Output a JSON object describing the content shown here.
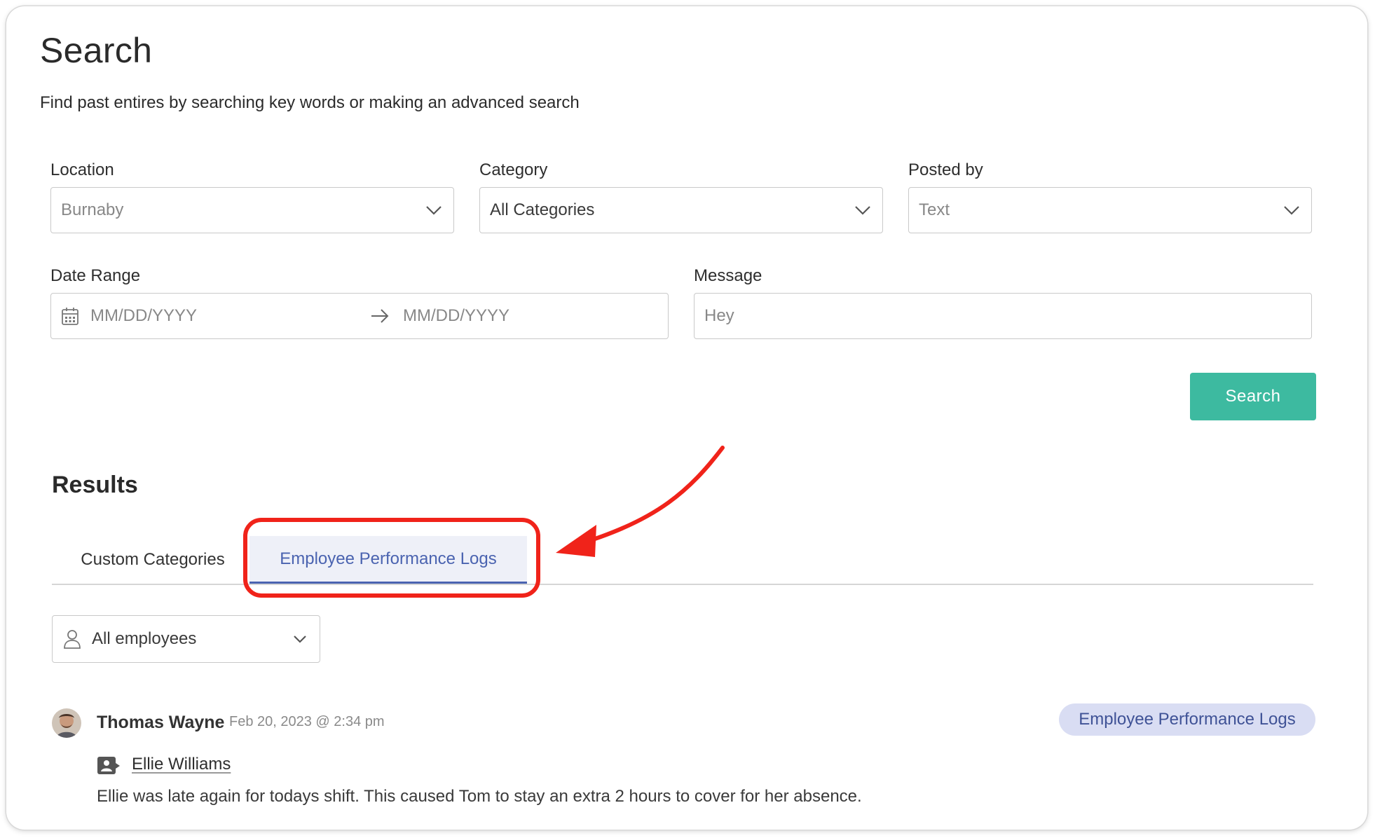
{
  "page": {
    "title": "Search",
    "subtitle": "Find past entires by searching key words or making an advanced search"
  },
  "filters": {
    "location": {
      "label": "Location",
      "value": "Burnaby"
    },
    "category": {
      "label": "Category",
      "value": "All Categories"
    },
    "posted_by": {
      "label": "Posted by",
      "value": "Text"
    },
    "date_range": {
      "label": "Date Range",
      "start_placeholder": "MM/DD/YYYY",
      "end_placeholder": "MM/DD/YYYY"
    },
    "message": {
      "label": "Message",
      "value": "Hey"
    },
    "search_button": "Search"
  },
  "results": {
    "title": "Results",
    "tabs": [
      {
        "label": "Custom Categories",
        "active": false
      },
      {
        "label": "Employee Performance Logs",
        "active": true
      }
    ],
    "employee_filter": {
      "value": "All employees"
    },
    "entries": [
      {
        "author": "Thomas Wayne",
        "timestamp": "Feb 20, 2023 @ 2:34 pm",
        "category_badge": "Employee Performance Logs",
        "employee": "Ellie Williams",
        "message": "Ellie was late again for todays shift. This caused Tom to stay an extra 2 hours to cover for her absence."
      }
    ]
  },
  "icons": {
    "chevron": "chevron-down-icon",
    "calendar": "calendar-icon",
    "arrow": "arrow-right-icon",
    "user": "user-icon",
    "contact": "contact-card-icon"
  },
  "colors": {
    "accent_button": "#3dbaa0",
    "tab_active_text": "#4a63b0",
    "tab_active_bg": "#eef0f8",
    "badge_bg": "#d9ddf3",
    "badge_text": "#3f5296",
    "annotation_red": "#f0231a"
  }
}
